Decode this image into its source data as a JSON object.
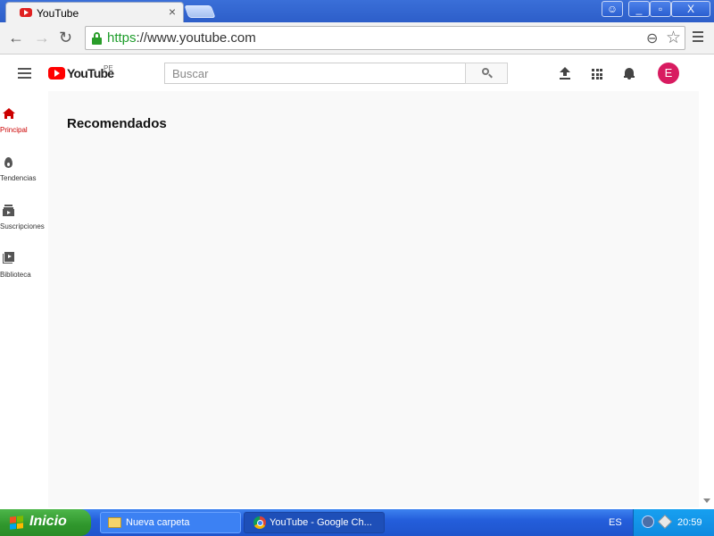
{
  "browser": {
    "tab_title": "YouTube",
    "tab_close": "×",
    "window_controls": {
      "account": "user-icon",
      "minimize": "_",
      "restore": "▫",
      "close": "X"
    },
    "nav": {
      "back": "←",
      "forward": "→",
      "reload": "↻"
    },
    "url_scheme": "https",
    "url_rest": "://www.youtube.com",
    "zoom_icon": "⊖",
    "bookmark_star": "☆"
  },
  "youtube": {
    "logo_text": "YouTube",
    "country_code": "PE",
    "search_placeholder": "Buscar",
    "avatar_letter": "E",
    "accent_color": "#ff0000",
    "avatar_color": "#d81b60",
    "guide": [
      {
        "label": "Principal",
        "icon": "home-icon",
        "active": true
      },
      {
        "label": "Tendencias",
        "icon": "trending-icon",
        "active": false
      },
      {
        "label": "Suscripciones",
        "icon": "subscriptions-icon",
        "active": false
      },
      {
        "label": "Biblioteca",
        "icon": "library-icon",
        "active": false
      }
    ],
    "section_title": "Recomendados"
  },
  "taskbar": {
    "start_label": "Inicio",
    "tasks": [
      {
        "label": "Nueva carpeta",
        "icon": "folder-icon"
      },
      {
        "label": "YouTube - Google Ch...",
        "icon": "chrome-icon"
      }
    ],
    "language": "ES",
    "clock": "20:59"
  }
}
